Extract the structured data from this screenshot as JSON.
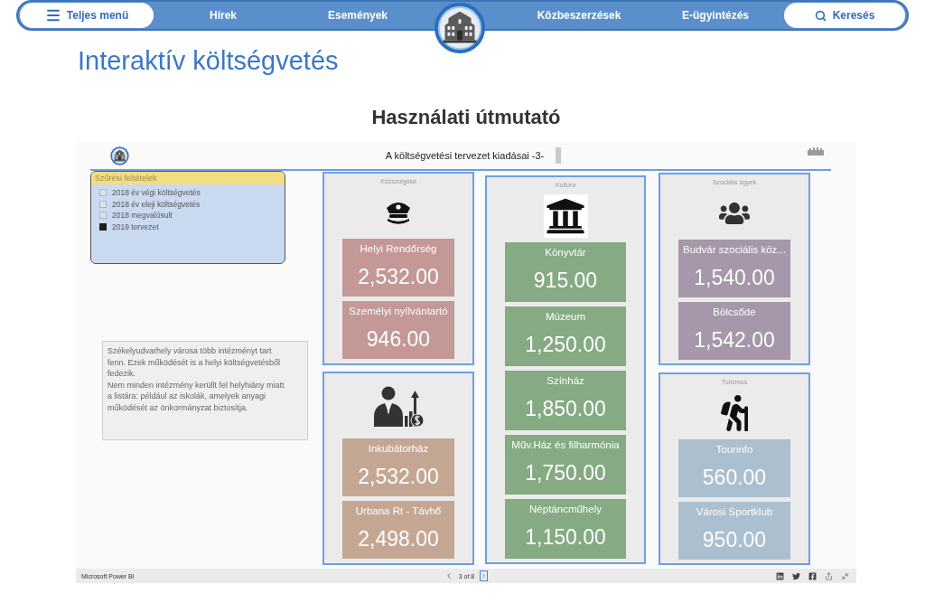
{
  "nav": {
    "menu_button": "Teljes menü",
    "links": [
      "Hírek",
      "Események",
      "Közbeszerzések",
      "E-ügyintézés"
    ],
    "search_button": "Keresés"
  },
  "page_title": "Interaktív költségvetés",
  "section_title": "Használati útmutató",
  "report": {
    "title": "A költségvetési tervezet kiadásai -3-",
    "filter_panel": {
      "title": "Szűrési feltételek",
      "options": [
        {
          "label": "2018 év végi költségvetés",
          "checked": false
        },
        {
          "label": "2018 év eleji költségvetés",
          "checked": false
        },
        {
          "label": "2018 megvalósult",
          "checked": false
        },
        {
          "label": "2019 tervezet",
          "checked": true
        }
      ]
    },
    "note": [
      "Székelyudvarhely városa több intézményt tart fenn. Ezek működését is a helyi költségvetésből fedezik.",
      "Nem minden intézmény kerüllt fel helyhiány miatt a listára: például az iskolák, amelyek anyagi működését az önkormányzat biztosítja."
    ],
    "columns": [
      {
        "groups": [
          {
            "label": "Közszolgálat",
            "color": "#c39896",
            "cards": [
              {
                "name": "Helyi Rendőrség",
                "value": "2,532.00"
              },
              {
                "name": "Személyi nyílvántartó",
                "value": "946.00"
              }
            ]
          },
          {
            "color": "#c4a793",
            "cards": [
              {
                "name": "Inkubátorház",
                "value": "2,532.00"
              },
              {
                "name": "Urbana Rt - Távhő",
                "value": "2,498.00"
              }
            ]
          }
        ]
      },
      {
        "groups": [
          {
            "label": "Kultúra",
            "color": "#86aa83",
            "cards": [
              {
                "name": "Könyvtár",
                "value": "915.00"
              },
              {
                "name": "Múzeum",
                "value": "1,250.00"
              },
              {
                "name": "Színház",
                "value": "1,850.00"
              },
              {
                "name": "Műv.Ház és filharmónia",
                "value": "1,750.00"
              },
              {
                "name": "Néptáncműhely",
                "value": "1,150.00"
              }
            ]
          }
        ]
      },
      {
        "groups": [
          {
            "label": "Szociális ügyek",
            "color": "#a797aa",
            "cards": [
              {
                "name": "Budvár szociális köz...",
                "value": "1,540.00"
              },
              {
                "name": "Bölcsőde",
                "value": "1,542.00"
              }
            ]
          },
          {
            "label": "Turizmus",
            "color": "#abbfcf",
            "cards": [
              {
                "name": "Tourinfo",
                "value": "560.00"
              },
              {
                "name": "Városi Sportklub",
                "value": "950.00"
              }
            ]
          }
        ]
      }
    ]
  },
  "footer": {
    "brand": "Microsoft Power BI",
    "page_indicator": "3 of 8"
  }
}
